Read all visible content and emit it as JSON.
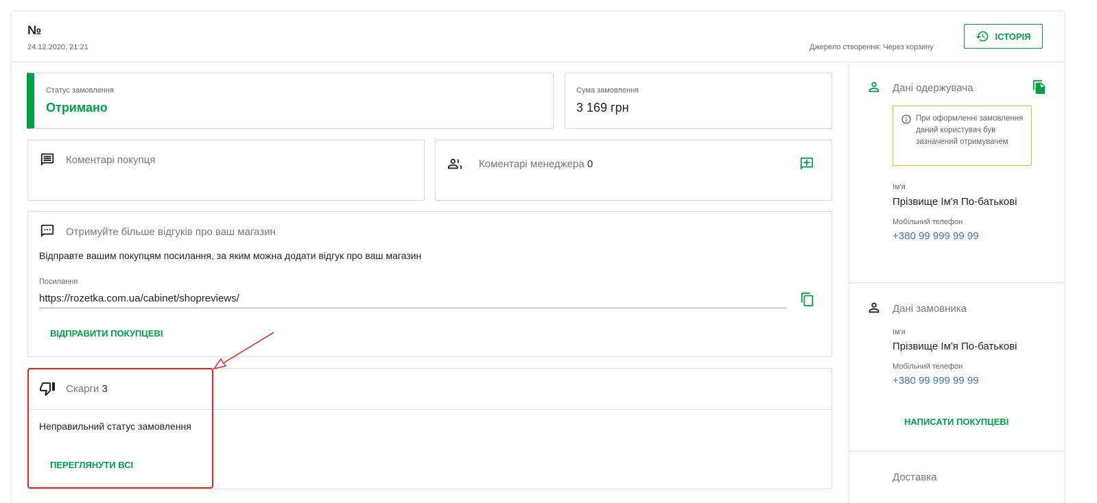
{
  "header": {
    "order_no": "№",
    "date": "24.12.2020, 21:21",
    "source": "Джерело створення: Через корзину",
    "history_label": "ІСТОРІЯ"
  },
  "status": {
    "label": "Статус замовлення",
    "value": "Отримано"
  },
  "sum": {
    "label": "Сума замовлення",
    "value": "3 169 грн"
  },
  "buyer_comments": {
    "title": "Коментарі покупця"
  },
  "manager_comments": {
    "title": "Коментарі менеджера",
    "count": "0"
  },
  "reviews": {
    "title": "Отримуйте більше відгуків про ваш магазин",
    "text": "Відправте вашим покупцям посилання, за яким можна додати відгук про ваш магазин",
    "link_label": "Посилання",
    "link_value": "https://rozetka.com.ua/cabinet/shopreviews/",
    "send_label": "ВІДПРАВИТИ ПОКУПЦЕВІ"
  },
  "complaints": {
    "title": "Скарги",
    "count": "3",
    "text": "Неправильний статус замовлення",
    "view_all_label": "ПЕРЕГЛЯНУТИ ВСІ"
  },
  "recipient": {
    "title": "Дані одержувача",
    "notice": "При оформленні замовлення даний користувач був зазначений отримувачем",
    "name_label": "Ім'я",
    "name_value": "Прізвище Ім'я По-батькові",
    "phone_label": "Мобільний телефон",
    "phone_value": "+380 99 999 99 99"
  },
  "customer": {
    "title": "Дані замовника",
    "name_label": "Ім'я",
    "name_value": "Прізвище Ім'я По-батькові",
    "phone_label": "Мобільний телефон",
    "phone_value": "+380 99 999 99 99",
    "write_label": "НАПИСАТИ ПОКУПЦЕВІ"
  },
  "delivery": {
    "title": "Доставка"
  },
  "colors": {
    "accent": "#00a046",
    "link": "#3e77aa",
    "warning_border": "#f3b42c",
    "highlight": "#ef1f1f"
  }
}
